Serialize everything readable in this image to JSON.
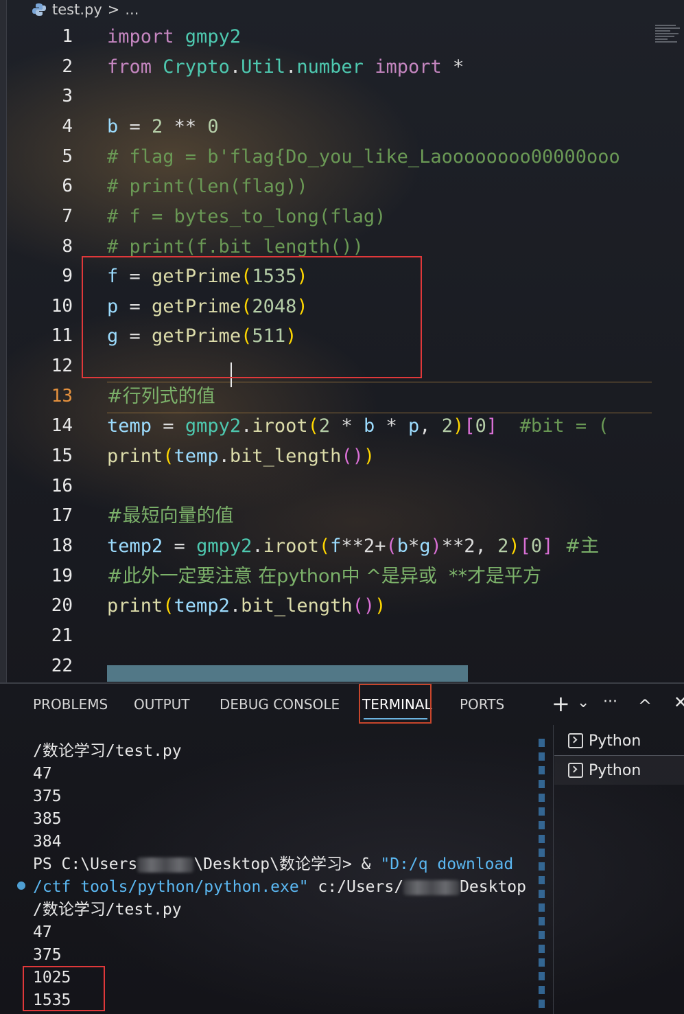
{
  "breadcrumb": {
    "file": "test.py",
    "separator": ">",
    "more": "..."
  },
  "editor": {
    "lines": [
      {
        "n": "1"
      },
      {
        "n": "2"
      },
      {
        "n": "3"
      },
      {
        "n": "4"
      },
      {
        "n": "5"
      },
      {
        "n": "6"
      },
      {
        "n": "7"
      },
      {
        "n": "8"
      },
      {
        "n": "9"
      },
      {
        "n": "10"
      },
      {
        "n": "11"
      },
      {
        "n": "12"
      },
      {
        "n": "13"
      },
      {
        "n": "14"
      },
      {
        "n": "15"
      },
      {
        "n": "16"
      },
      {
        "n": "17"
      },
      {
        "n": "18"
      },
      {
        "n": "19"
      },
      {
        "n": "20"
      },
      {
        "n": "21"
      },
      {
        "n": "22"
      }
    ],
    "active_line": "13",
    "code": {
      "l1_kw": "import",
      "l1_mod": " gmpy2",
      "l2_kw": "from",
      "l2_mod": " Crypto",
      "l2_dot1": ".",
      "l2_util": "Util",
      "l2_dot2": ".",
      "l2_number": "number",
      "l2_kw2": " import",
      "l2_star": " *",
      "l4_var": "b",
      "l4_eq": " = ",
      "l4_n1": "2",
      "l4_op": " ** ",
      "l4_n2": "0",
      "l5": "# flag = b'flag{Do_you_like_Laoooooooo00000ooo",
      "l6": "# print(len(flag))",
      "l7": "# f = bytes_to_long(flag)",
      "l8": "# print(f.bit_length())",
      "l9_var": "f",
      "l9_eq": " = ",
      "l9_fn": "getPrime",
      "l9_num": "1535",
      "l10_var": "p",
      "l10_eq": " = ",
      "l10_fn": "getPrime",
      "l10_num": "2048",
      "l11_var": "g",
      "l11_eq": " = ",
      "l11_fn": "getPrime",
      "l11_num": "511",
      "l13": "#行列式的值",
      "l14_var": "temp",
      "l14_eq": " = ",
      "l14_mod": "gmpy2",
      "l14_fn": "iroot",
      "l14_n1": "2",
      "l14_b": "b",
      "l14_p": "p",
      "l14_n2": "2",
      "l14_idx": "0",
      "l14_cm": "  #bit = (",
      "l15_fn": "print",
      "l15_var": "temp",
      "l15_fn2": "bit_length",
      "l17": "#最短向量的值",
      "l18_var": "temp2",
      "l18_eq": " = ",
      "l18_mod": "gmpy2",
      "l18_fn": "iroot",
      "l18_f": "f",
      "l18_pow": "**2+",
      "l18_b": "b",
      "l18_g": "g",
      "l18_pow2": "**2, ",
      "l18_n2": "2",
      "l18_idx": "0",
      "l18_cm": "  #主",
      "l19": "#此外一定要注意 在python中 ^是异或  **才是平方",
      "l20_fn": "print",
      "l20_var": "temp2",
      "l20_fn2": "bit_length"
    }
  },
  "panel": {
    "tabs": [
      "PROBLEMS",
      "OUTPUT",
      "DEBUG CONSOLE",
      "TERMINAL",
      "PORTS"
    ],
    "active_tab": "TERMINAL",
    "actions": {
      "add": "+",
      "dropdown": "⌄",
      "more": "···",
      "maximize": "^",
      "close": "✕"
    }
  },
  "terminal": {
    "l1": "/数论学习/test.py",
    "l2": "47",
    "l3": "375",
    "l4": "385",
    "l5": "384",
    "l6_prefix": "PS C:\\Users",
    "l6_mid": "\\Desktop\\数论学习> & ",
    "l6_quote": "\"D:/q download",
    "l7_quote": "/ctf tools/python/python.exe\"",
    "l7_mid": " c:/Users/",
    "l7_end": "Desktop",
    "l8": "/数论学习/test.py",
    "l9": "47",
    "l10": "375",
    "l11": "1025",
    "l12": "1535"
  },
  "terminal_list": [
    {
      "label": "Python"
    },
    {
      "label": "Python"
    }
  ]
}
